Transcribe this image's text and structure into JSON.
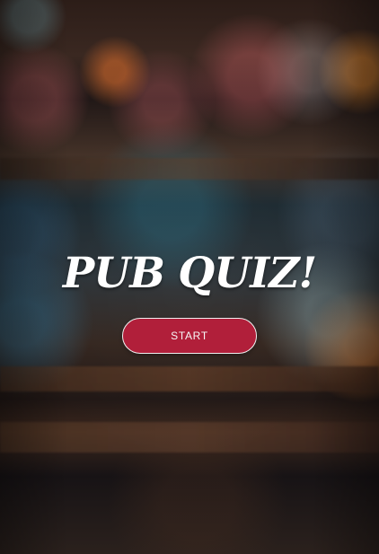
{
  "screen": {
    "title": "PUB QUIZ!",
    "start_button_label": "START"
  },
  "colors": {
    "title_text": "#ffffff",
    "start_button_background": "#b11f3a",
    "start_button_border": "#f0f0f0",
    "background_dark": "#141210"
  }
}
